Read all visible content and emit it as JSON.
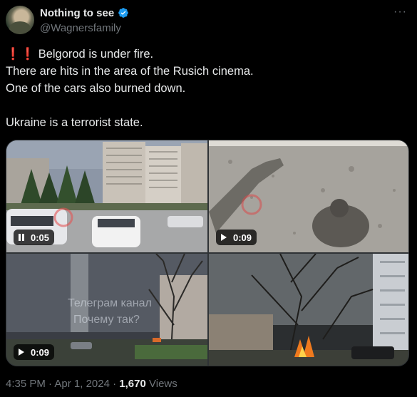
{
  "author": {
    "display_name": "Nothing to see",
    "handle": "@Wagnersfamily",
    "verified": true,
    "verified_color": "#1d9bf0"
  },
  "menu": {
    "more_icon": "more-icon"
  },
  "tweet": {
    "lines": [
      "Belgorod is under fire.",
      "There are hits in the area of the Rusich cinema.",
      "One of the cars also burned down.",
      "Ukraine is a terrorist state."
    ],
    "emoji_prefix": "❗❗"
  },
  "media": [
    {
      "kind": "video",
      "state": "playing",
      "duration": "0:05"
    },
    {
      "kind": "video",
      "state": "paused",
      "duration": "0:09"
    },
    {
      "kind": "video",
      "state": "paused",
      "duration": "0:09",
      "overlay_lines": [
        "Телеграм канал",
        "Почему так?"
      ]
    },
    {
      "kind": "video",
      "state": "paused"
    }
  ],
  "footer": {
    "time": "4:35 PM",
    "sep": "·",
    "date": "Apr 1, 2024",
    "views_count": "1,670",
    "views_label": "Views"
  },
  "colors": {
    "background": "#000000",
    "text": "#e7e9ea",
    "muted": "#71767b",
    "alert": "#e0323c"
  }
}
